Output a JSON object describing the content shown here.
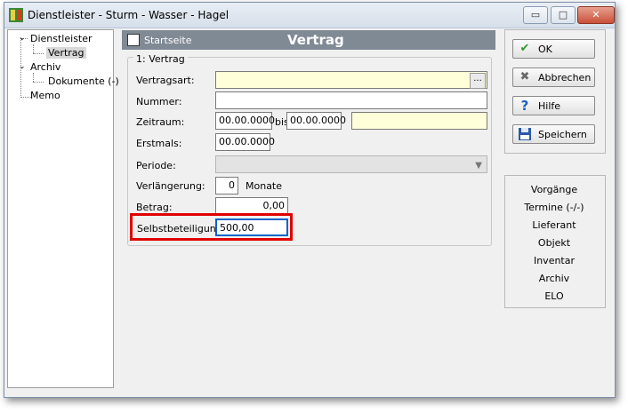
{
  "window": {
    "title": "Dienstleister - Sturm - Wasser - Hagel",
    "min_symbol": "▭",
    "max_symbol": "□",
    "close_symbol": "✕"
  },
  "tree": {
    "items": [
      {
        "label": "Dienstleister"
      },
      {
        "label": "Vertrag"
      },
      {
        "label": "Archiv"
      },
      {
        "label": "Dokumente (-)"
      },
      {
        "label": "Memo"
      }
    ]
  },
  "header": {
    "startseite": "Startseite",
    "title": "Vertrag"
  },
  "form": {
    "group_label": "1: Vertrag",
    "vertragsart_label": "Vertragsart:",
    "vertragsart_value": "",
    "vertragsart_btn": "...",
    "nummer_label": "Nummer:",
    "nummer_value": "",
    "zeitraum_label": "Zeitraum:",
    "zeitraum_from": "00.00.0000",
    "bis_label": "bis",
    "zeitraum_to": "00.00.0000",
    "zeitraum_extra": "",
    "erstmals_label": "Erstmals:",
    "erstmals_value": "00.00.0000",
    "periode_label": "Periode:",
    "periode_value": "",
    "verlaengerung_label": "Verlängerung:",
    "verlaengerung_value": "0",
    "monate_label": "Monate",
    "betrag_label": "Betrag:",
    "betrag_value": "0,00",
    "selbst_label": "Selbstbeteiligung:",
    "selbst_value": "500,00"
  },
  "buttons": {
    "ok": "OK",
    "abbrechen": "Abbrechen",
    "hilfe": "Hilfe",
    "speichern": "Speichern"
  },
  "nav": {
    "items": [
      "Vorgänge",
      "Termine (-/-)",
      "Lieferant",
      "Objekt",
      "Inventar",
      "Archiv",
      "ELO"
    ]
  },
  "colors": {
    "highlight": "#e00000",
    "header_bg": "#808a95",
    "yellow_field": "#ffffd9"
  },
  "icons": {
    "ok": "check-icon",
    "abbrechen": "cross-icon",
    "hilfe": "question-icon",
    "speichern": "floppy-icon"
  }
}
